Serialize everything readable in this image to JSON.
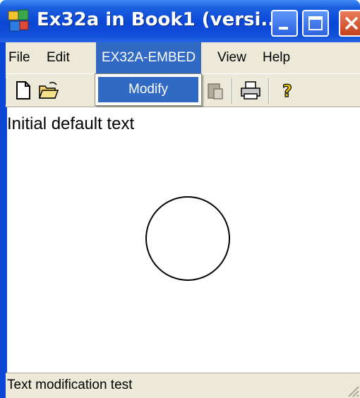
{
  "window": {
    "title": "Ex32a in Book1 (versi...",
    "accent_color": "#0a46d6",
    "controls": [
      "minimize-icon",
      "maximize-icon",
      "close-icon"
    ]
  },
  "menubar": {
    "items": [
      {
        "label": "File"
      },
      {
        "label": "Edit"
      },
      {
        "label": "EX32A-EMBED",
        "active": true
      },
      {
        "label": "View"
      },
      {
        "label": "Help"
      }
    ]
  },
  "dropdown": {
    "items": [
      {
        "label": "Modify",
        "highlighted": true
      }
    ]
  },
  "toolbar": {
    "icons": [
      "new-document-icon",
      "open-folder-icon",
      "paste-icon",
      "print-icon",
      "help-icon"
    ]
  },
  "document": {
    "text": "Initial default text",
    "shape": "circle"
  },
  "statusbar": {
    "text": "Text modification test"
  }
}
